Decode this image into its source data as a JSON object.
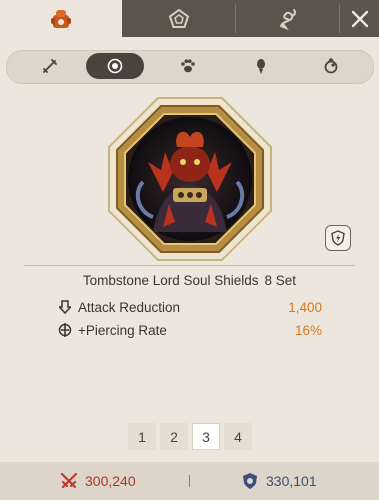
{
  "top_tabs": [
    {
      "icon": "armor-set-icon",
      "active": true
    },
    {
      "icon": "pentagon-icon",
      "active": false
    },
    {
      "icon": "dragon-icon",
      "active": false
    }
  ],
  "close_icon": "close-icon",
  "sub_tabs": [
    {
      "icon": "weapon-icon",
      "active": false
    },
    {
      "icon": "shield-orb-icon",
      "active": true
    },
    {
      "icon": "paw-icon",
      "active": false
    },
    {
      "icon": "spirit-icon",
      "active": false
    },
    {
      "icon": "ring-icon",
      "active": false
    }
  ],
  "set": {
    "name": "Tombstone Lord Soul Shields",
    "count": "8 Set"
  },
  "stats": [
    {
      "label": "Attack Reduction",
      "value": "1,400",
      "icon": "arrow-down-icon"
    },
    {
      "label": "+Piercing Rate",
      "value": "16%",
      "icon": "pierce-icon"
    }
  ],
  "pages": [
    "1",
    "2",
    "3",
    "4"
  ],
  "active_page": "3",
  "footer": {
    "attack": "300,240",
    "defense": "330,101"
  },
  "colors": {
    "accent_value": "#d37a1f",
    "attack_icon": "#c0392b",
    "defense_icon": "#3d4f7a"
  }
}
